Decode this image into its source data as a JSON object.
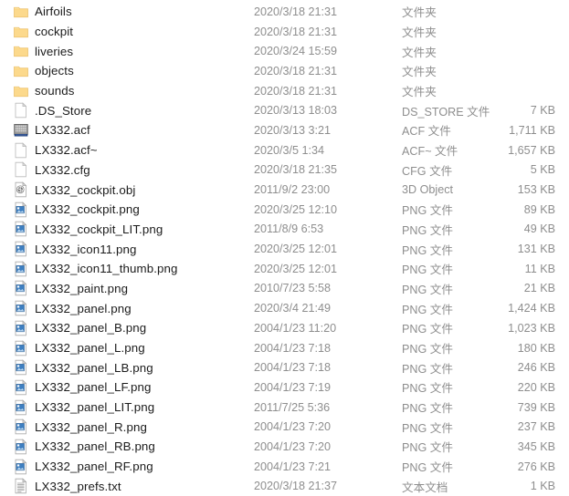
{
  "window": {
    "view": "details-list",
    "background_color": "#ffffff",
    "name_text_color": "#1b1b1b",
    "meta_text_color": "#8e8e8e",
    "folder_icon_color": "#fbd277",
    "png_icon_accent_color": "#3e7fc1"
  },
  "columns": {
    "name": "",
    "date": "",
    "type": "",
    "size": ""
  },
  "files": [
    {
      "name": "Airfoils",
      "date": "2020/3/18 21:31",
      "type": "文件夹",
      "size": "",
      "icon": "folder-icon"
    },
    {
      "name": "cockpit",
      "date": "2020/3/18 21:31",
      "type": "文件夹",
      "size": "",
      "icon": "folder-icon"
    },
    {
      "name": "liveries",
      "date": "2020/3/24 15:59",
      "type": "文件夹",
      "size": "",
      "icon": "folder-icon"
    },
    {
      "name": "objects",
      "date": "2020/3/18 21:31",
      "type": "文件夹",
      "size": "",
      "icon": "folder-icon"
    },
    {
      "name": "sounds",
      "date": "2020/3/18 21:31",
      "type": "文件夹",
      "size": "",
      "icon": "folder-icon"
    },
    {
      "name": ".DS_Store",
      "date": "2020/3/13 18:03",
      "type": "DS_STORE 文件",
      "size": "7 KB",
      "icon": "blank-document-icon"
    },
    {
      "name": "LX332.acf",
      "date": "2020/3/13 3:21",
      "type": "ACF 文件",
      "size": "1,711 KB",
      "icon": "acf-file-icon"
    },
    {
      "name": "LX332.acf~",
      "date": "2020/3/5 1:34",
      "type": "ACF~ 文件",
      "size": "1,657 KB",
      "icon": "blank-document-icon"
    },
    {
      "name": "LX332.cfg",
      "date": "2020/3/18 21:35",
      "type": "CFG 文件",
      "size": "5 KB",
      "icon": "blank-document-icon"
    },
    {
      "name": "LX332_cockpit.obj",
      "date": "2011/9/2 23:00",
      "type": "3D Object",
      "size": "153 KB",
      "icon": "3d-object-icon"
    },
    {
      "name": "LX332_cockpit.png",
      "date": "2020/3/25 12:10",
      "type": "PNG 文件",
      "size": "89 KB",
      "icon": "png-image-icon"
    },
    {
      "name": "LX332_cockpit_LIT.png",
      "date": "2011/8/9 6:53",
      "type": "PNG 文件",
      "size": "49 KB",
      "icon": "png-image-icon"
    },
    {
      "name": "LX332_icon11.png",
      "date": "2020/3/25 12:01",
      "type": "PNG 文件",
      "size": "131 KB",
      "icon": "png-image-icon"
    },
    {
      "name": "LX332_icon11_thumb.png",
      "date": "2020/3/25 12:01",
      "type": "PNG 文件",
      "size": "11 KB",
      "icon": "png-image-icon"
    },
    {
      "name": "LX332_paint.png",
      "date": "2010/7/23 5:58",
      "type": "PNG 文件",
      "size": "21 KB",
      "icon": "png-image-icon"
    },
    {
      "name": "LX332_panel.png",
      "date": "2020/3/4 21:49",
      "type": "PNG 文件",
      "size": "1,424 KB",
      "icon": "png-image-icon"
    },
    {
      "name": "LX332_panel_B.png",
      "date": "2004/1/23 11:20",
      "type": "PNG 文件",
      "size": "1,023 KB",
      "icon": "png-image-icon"
    },
    {
      "name": "LX332_panel_L.png",
      "date": "2004/1/23 7:18",
      "type": "PNG 文件",
      "size": "180 KB",
      "icon": "png-image-icon"
    },
    {
      "name": "LX332_panel_LB.png",
      "date": "2004/1/23 7:18",
      "type": "PNG 文件",
      "size": "246 KB",
      "icon": "png-image-icon"
    },
    {
      "name": "LX332_panel_LF.png",
      "date": "2004/1/23 7:19",
      "type": "PNG 文件",
      "size": "220 KB",
      "icon": "png-image-icon"
    },
    {
      "name": "LX332_panel_LIT.png",
      "date": "2011/7/25 5:36",
      "type": "PNG 文件",
      "size": "739 KB",
      "icon": "png-image-icon"
    },
    {
      "name": "LX332_panel_R.png",
      "date": "2004/1/23 7:20",
      "type": "PNG 文件",
      "size": "237 KB",
      "icon": "png-image-icon"
    },
    {
      "name": "LX332_panel_RB.png",
      "date": "2004/1/23 7:20",
      "type": "PNG 文件",
      "size": "345 KB",
      "icon": "png-image-icon"
    },
    {
      "name": "LX332_panel_RF.png",
      "date": "2004/1/23 7:21",
      "type": "PNG 文件",
      "size": "276 KB",
      "icon": "png-image-icon"
    },
    {
      "name": "LX332_prefs.txt",
      "date": "2020/3/18 21:37",
      "type": "文本文档",
      "size": "1 KB",
      "icon": "text-document-icon"
    }
  ]
}
